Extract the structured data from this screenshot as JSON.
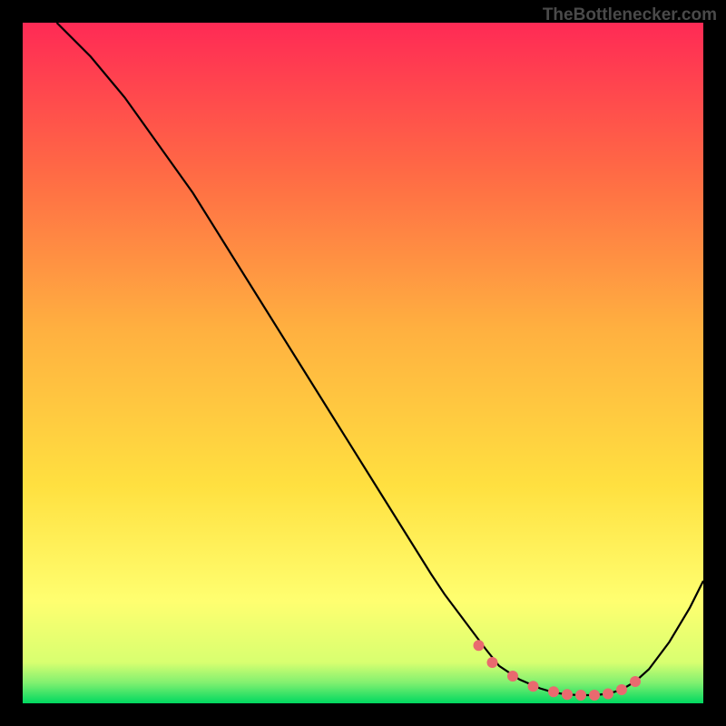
{
  "watermark": "TheBottlenecker.com",
  "chart_data": {
    "type": "line",
    "title": "",
    "xlabel": "",
    "ylabel": "",
    "xlim": [
      0,
      100
    ],
    "ylim": [
      0,
      100
    ],
    "background_gradient": {
      "top": "#ff2a55",
      "upper_mid": "#ff8040",
      "mid": "#ffd040",
      "lower_mid": "#ffff60",
      "near_bottom": "#d0ff60",
      "bottom": "#00e060"
    },
    "series": [
      {
        "name": "curve",
        "color": "#000000",
        "x": [
          5,
          10,
          15,
          20,
          25,
          30,
          35,
          40,
          45,
          50,
          55,
          60,
          62,
          65,
          68,
          70,
          73,
          76,
          78,
          80,
          82,
          84,
          86,
          88,
          90,
          92,
          95,
          98,
          100
        ],
        "y": [
          100,
          95,
          89,
          82,
          75,
          67,
          59,
          51,
          43,
          35,
          27,
          19,
          16,
          12,
          8,
          5.5,
          3.5,
          2.2,
          1.6,
          1.3,
          1.2,
          1.2,
          1.4,
          2.0,
          3.2,
          5.0,
          9.0,
          14,
          18
        ]
      }
    ],
    "highlight_points": {
      "color": "#e96a6f",
      "x": [
        67,
        69,
        72,
        75,
        78,
        80,
        82,
        84,
        86,
        88,
        90
      ],
      "y": [
        8.5,
        6.0,
        4.0,
        2.5,
        1.7,
        1.3,
        1.2,
        1.2,
        1.4,
        2.0,
        3.2
      ]
    }
  }
}
